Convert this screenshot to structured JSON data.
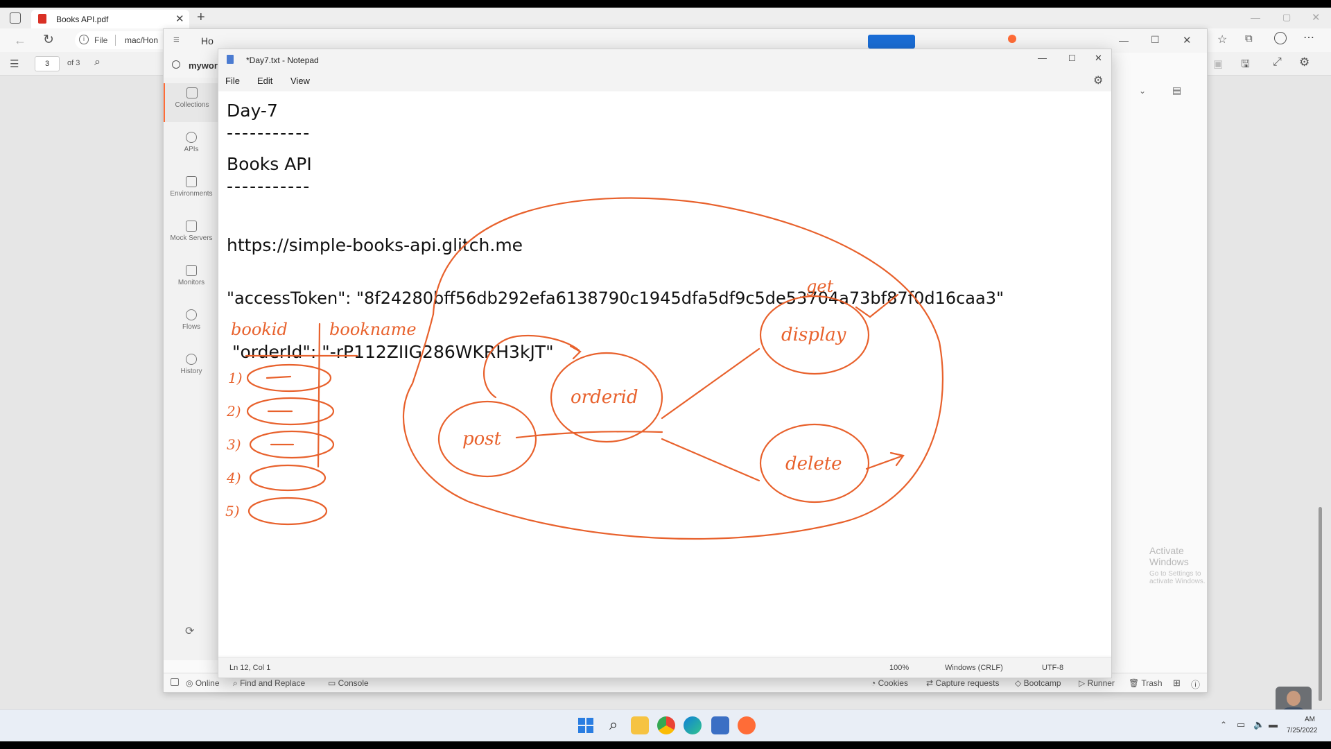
{
  "browser": {
    "tab_title": "Books API.pdf",
    "address_file_label": "File",
    "address_path": "mac/Hon",
    "pdf_page_current": "3",
    "pdf_page_total": "of 3"
  },
  "postman": {
    "home_label": "Ho",
    "workspace_label": "mywor",
    "nav": [
      {
        "label": "Collections"
      },
      {
        "label": "APIs"
      },
      {
        "label": "Environments"
      },
      {
        "label": "Mock Servers"
      },
      {
        "label": "Monitors"
      },
      {
        "label": "Flows"
      },
      {
        "label": "History"
      }
    ],
    "footer": {
      "online": "Online",
      "find_replace": "Find and Replace",
      "console": "Console",
      "cookies": "Cookies",
      "capture": "Capture requests",
      "bootcamp": "Bootcamp",
      "runner": "Runner",
      "trash": "Trash"
    }
  },
  "notepad": {
    "title": "*Day7.txt - Notepad",
    "menu": {
      "file": "File",
      "edit": "Edit",
      "view": "View"
    },
    "lines": [
      "Day-7",
      "-----------",
      "Books API",
      "-----------",
      "https://simple-books-api.glitch.me",
      "\"accessToken\": \"8f24280bff56db292efa6138790c1945dfa5df9c5de53704a73bf87f0d16caa3\"",
      " \"orderId\": \"-rP112ZIIG286WKRH3kJT\""
    ],
    "status": {
      "position": "Ln 12, Col 1",
      "zoom": "100%",
      "line_ending": "Windows (CRLF)",
      "encoding": "UTF-8"
    }
  },
  "annotations": {
    "table_headers": [
      "bookid",
      "bookname"
    ],
    "row_numbers": [
      "1)",
      "2)",
      "3)",
      "4)",
      "5)"
    ],
    "nodes": {
      "post": "post",
      "orderid": "orderid",
      "display": "display",
      "delete": "delete",
      "get": "get"
    }
  },
  "watermark": {
    "line1": "Activate Windows",
    "line2": "Go to Settings to activate Windows."
  },
  "taskbar": {
    "time": "AM",
    "date": "7/25/2022"
  },
  "colors": {
    "ink": "#e8612c",
    "taskbar": "#e9eef6",
    "postman_orange": "#ff6c37"
  }
}
